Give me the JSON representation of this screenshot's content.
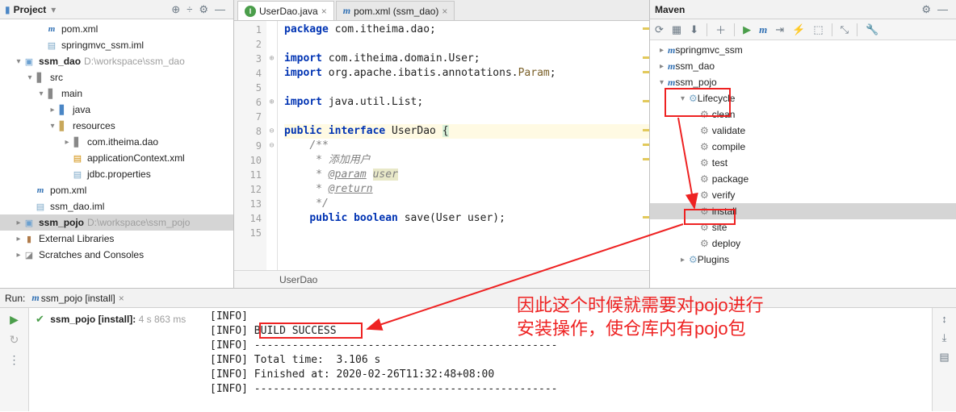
{
  "project": {
    "title": "Project",
    "tree": [
      {
        "indent": 46,
        "arrow": "",
        "icon": "m",
        "label": "pom.xml"
      },
      {
        "indent": 46,
        "arrow": "",
        "icon": "iml",
        "label": "springmvc_ssm.iml"
      },
      {
        "indent": 18,
        "arrow": "▾",
        "icon": "mod",
        "label": "ssm_dao",
        "bold": true,
        "path": "D:\\workspace\\ssm_dao"
      },
      {
        "indent": 32,
        "arrow": "▾",
        "icon": "folder-gray",
        "label": "src"
      },
      {
        "indent": 46,
        "arrow": "▾",
        "icon": "folder-gray",
        "label": "main"
      },
      {
        "indent": 60,
        "arrow": "▸",
        "icon": "folder-blue",
        "label": "java"
      },
      {
        "indent": 60,
        "arrow": "▾",
        "icon": "folder-yellow",
        "label": "resources"
      },
      {
        "indent": 78,
        "arrow": "▸",
        "icon": "folder-gray",
        "label": "com.itheima.dao"
      },
      {
        "indent": 78,
        "arrow": "",
        "icon": "xml",
        "label": "applicationContext.xml"
      },
      {
        "indent": 78,
        "arrow": "",
        "icon": "iml",
        "label": "jdbc.properties"
      },
      {
        "indent": 32,
        "arrow": "",
        "icon": "m",
        "label": "pom.xml"
      },
      {
        "indent": 32,
        "arrow": "",
        "icon": "iml",
        "label": "ssm_dao.iml"
      },
      {
        "indent": 18,
        "arrow": "▸",
        "icon": "mod",
        "label": "ssm_pojo",
        "bold": true,
        "path": "D:\\workspace\\ssm_pojo",
        "selected": true
      },
      {
        "indent": 18,
        "arrow": "▸",
        "icon": "lib",
        "label": "External Libraries"
      },
      {
        "indent": 18,
        "arrow": "▸",
        "icon": "scratch",
        "label": "Scratches and Consoles"
      }
    ]
  },
  "tabs": [
    {
      "icon": "i",
      "label": "UserDao.java",
      "active": true
    },
    {
      "icon": "m",
      "label": "pom.xml (ssm_dao)",
      "active": false
    }
  ],
  "code_lines": [
    {
      "n": 1,
      "html": "<span class='kw'>package</span> com.itheima.dao;"
    },
    {
      "n": 2,
      "html": ""
    },
    {
      "n": 3,
      "html": "<span class='kw'>import</span> com.itheima.domain.User;",
      "fold": "⊕"
    },
    {
      "n": 4,
      "html": "<span class='kw'>import</span> org.apache.ibatis.annotations.<span class='param'>Param</span>;"
    },
    {
      "n": 5,
      "html": ""
    },
    {
      "n": 6,
      "html": "<span class='kw'>import</span> java.util.List;",
      "fold": "⊕"
    },
    {
      "n": 7,
      "html": ""
    },
    {
      "n": 8,
      "html": "<span class='kw'>public interface</span> UserDao <span class='brace-hl'>{</span>",
      "hl": true,
      "fold": "⊖"
    },
    {
      "n": 9,
      "html": "    <span class='comment'>/**</span>",
      "fold": "⊖"
    },
    {
      "n": 10,
      "html": "    <span class='comment'> * 添加用户</span>"
    },
    {
      "n": 11,
      "html": "    <span class='comment'> * <span class='doctag'>@param</span> <span class='docparam'>user</span></span>"
    },
    {
      "n": 12,
      "html": "    <span class='comment'> * <span class='doctag'>@return</span></span>"
    },
    {
      "n": 13,
      "html": "    <span class='comment'> */</span>"
    },
    {
      "n": 14,
      "html": "    <span class='kw'>public boolean</span> save(User user);"
    },
    {
      "n": 15,
      "html": ""
    }
  ],
  "breadcrumb": "UserDao",
  "maven": {
    "title": "Maven",
    "tree": [
      {
        "indent": 6,
        "arrow": "▸",
        "icon": "m",
        "label": "springmvc_ssm"
      },
      {
        "indent": 6,
        "arrow": "▸",
        "icon": "m",
        "label": "ssm_dao"
      },
      {
        "indent": 6,
        "arrow": "▾",
        "icon": "m",
        "label": "ssm_pojo"
      },
      {
        "indent": 32,
        "arrow": "▾",
        "icon": "cycle",
        "label": "Lifecycle"
      },
      {
        "indent": 46,
        "arrow": "",
        "icon": "gear",
        "label": "clean"
      },
      {
        "indent": 46,
        "arrow": "",
        "icon": "gear",
        "label": "validate"
      },
      {
        "indent": 46,
        "arrow": "",
        "icon": "gear",
        "label": "compile"
      },
      {
        "indent": 46,
        "arrow": "",
        "icon": "gear",
        "label": "test"
      },
      {
        "indent": 46,
        "arrow": "",
        "icon": "gear",
        "label": "package"
      },
      {
        "indent": 46,
        "arrow": "",
        "icon": "gear",
        "label": "verify"
      },
      {
        "indent": 46,
        "arrow": "",
        "icon": "gear",
        "label": "install",
        "selected": true
      },
      {
        "indent": 46,
        "arrow": "",
        "icon": "gear",
        "label": "site"
      },
      {
        "indent": 46,
        "arrow": "",
        "icon": "gear",
        "label": "deploy"
      },
      {
        "indent": 32,
        "arrow": "▸",
        "icon": "cycle",
        "label": "Plugins"
      }
    ]
  },
  "run": {
    "title": "Run:",
    "tab": "ssm_pojo [install]",
    "status_name": "ssm_pojo [install]:",
    "status_time": "4 s 863 ms",
    "console": [
      "[INFO] ",
      "[INFO] BUILD SUCCESS",
      "[INFO] ------------------------------------------------",
      "[INFO] Total time:  3.106 s",
      "[INFO] Finished at: 2020-02-26T11:32:48+08:00",
      "[INFO] ------------------------------------------------"
    ]
  },
  "annotation": {
    "line1": "因此这个时候就需要对pojo进行",
    "line2": "安装操作，使仓库内有pojo包"
  }
}
